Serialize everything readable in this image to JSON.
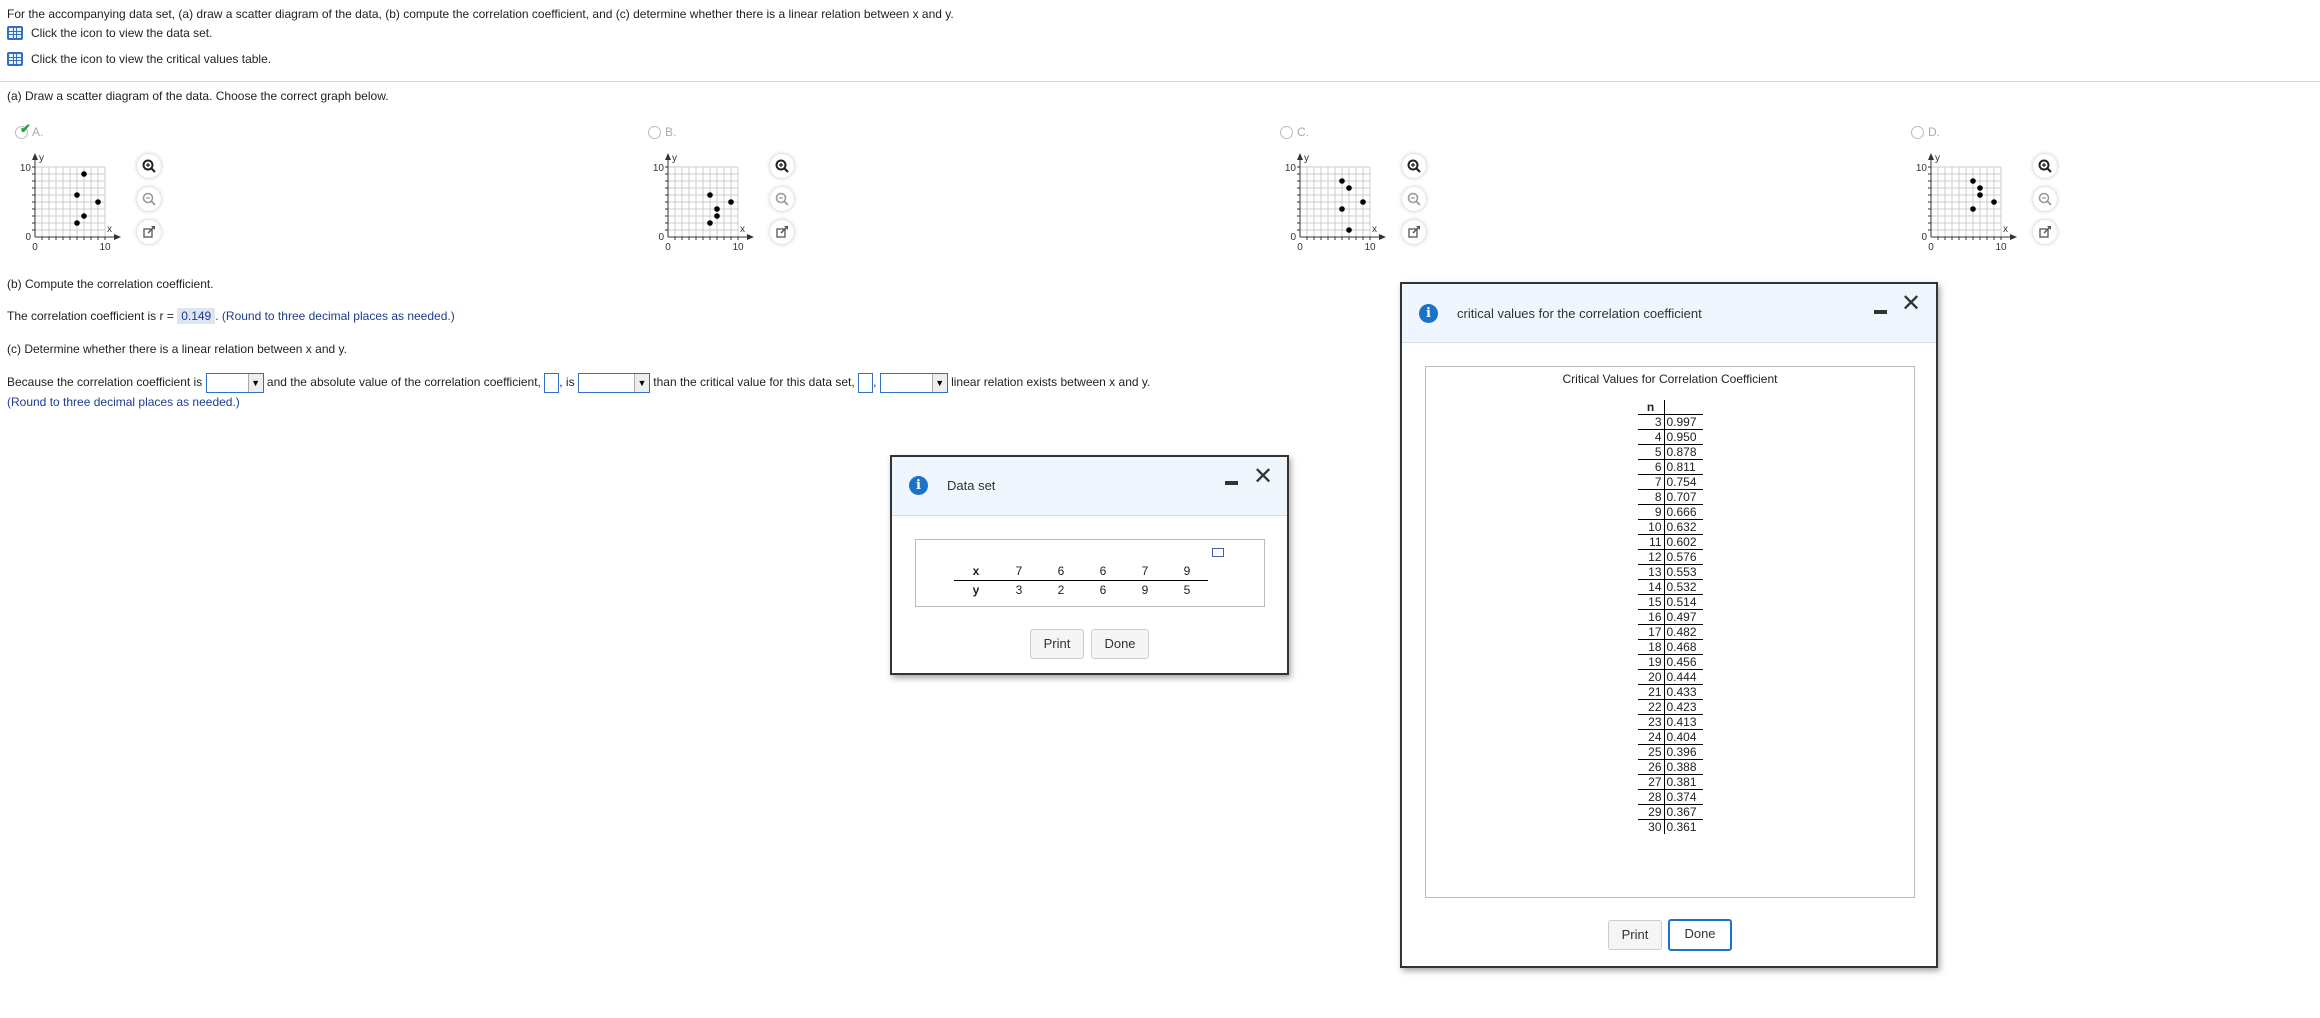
{
  "instructions": {
    "prompt": "For the accompanying data set, (a) draw a scatter diagram of the data, (b) compute the correlation coefficient, and (c) determine whether there is a linear relation between x and y.",
    "data_link": "Click the icon to view the data set.",
    "critical_link": "Click the icon to view the critical values table."
  },
  "part_a": {
    "prompt": "(a) Draw a scatter diagram of the data. Choose the correct graph below.",
    "options": [
      {
        "label": "A.",
        "selected": true,
        "points": [
          [
            7,
            9
          ],
          [
            6,
            6
          ],
          [
            9,
            5
          ],
          [
            7,
            3
          ],
          [
            6,
            2
          ]
        ]
      },
      {
        "label": "B.",
        "selected": false,
        "points": [
          [
            6,
            6
          ],
          [
            9,
            5
          ],
          [
            7,
            4
          ],
          [
            7,
            3
          ],
          [
            6,
            2
          ]
        ]
      },
      {
        "label": "C.",
        "selected": false,
        "points": [
          [
            6,
            8
          ],
          [
            7,
            7
          ],
          [
            9,
            5
          ],
          [
            6,
            4
          ],
          [
            7,
            1
          ]
        ]
      },
      {
        "label": "D.",
        "selected": false,
        "points": [
          [
            6,
            8
          ],
          [
            7,
            7
          ],
          [
            7,
            6
          ],
          [
            9,
            5
          ],
          [
            6,
            4
          ]
        ]
      }
    ],
    "axis": {
      "xlabel": "x",
      "ylabel": "y",
      "min_label": "0",
      "max_label": "10",
      "xmax_label": "10"
    }
  },
  "part_b": {
    "prompt": "(b) Compute the correlation coefficient.",
    "prefix": "The correlation coefficient is r =",
    "value": "0.149",
    "hint": ". (Round to three decimal places as needed.)"
  },
  "part_c": {
    "prompt": "(c) Determine whether there is a linear relation between x and y.",
    "s1": "Because the correlation coefficient is",
    "s2": "and the absolute value of the correlation coefficient,",
    "s3": ", is",
    "s4": "than the critical value for this data set,",
    "s5": ",",
    "s6": "linear relation exists between x and y.",
    "hint": "(Round to three decimal places as needed.)",
    "dropdown_arrow": "▼"
  },
  "data_dialog": {
    "title": "Data set",
    "x_label": "x",
    "y_label": "y",
    "x": [
      "7",
      "6",
      "6",
      "7",
      "9"
    ],
    "y": [
      "3",
      "2",
      "6",
      "9",
      "5"
    ],
    "print": "Print",
    "done": "Done"
  },
  "critical_dialog": {
    "title": "critical values for the correlation coefficient",
    "table_title": "Critical Values for Correlation Coefficient",
    "n_header": "n",
    "rows": [
      [
        "3",
        "0.997"
      ],
      [
        "4",
        "0.950"
      ],
      [
        "5",
        "0.878"
      ],
      [
        "6",
        "0.811"
      ],
      [
        "7",
        "0.754"
      ],
      [
        "8",
        "0.707"
      ],
      [
        "9",
        "0.666"
      ],
      [
        "10",
        "0.632"
      ],
      [
        "11",
        "0.602"
      ],
      [
        "12",
        "0.576"
      ],
      [
        "13",
        "0.553"
      ],
      [
        "14",
        "0.532"
      ],
      [
        "15",
        "0.514"
      ],
      [
        "16",
        "0.497"
      ],
      [
        "17",
        "0.482"
      ],
      [
        "18",
        "0.468"
      ],
      [
        "19",
        "0.456"
      ],
      [
        "20",
        "0.444"
      ],
      [
        "21",
        "0.433"
      ],
      [
        "22",
        "0.423"
      ],
      [
        "23",
        "0.413"
      ],
      [
        "24",
        "0.404"
      ],
      [
        "25",
        "0.396"
      ],
      [
        "26",
        "0.388"
      ],
      [
        "27",
        "0.381"
      ],
      [
        "28",
        "0.374"
      ],
      [
        "29",
        "0.367"
      ],
      [
        "30",
        "0.361"
      ]
    ],
    "print": "Print",
    "done": "Done"
  }
}
